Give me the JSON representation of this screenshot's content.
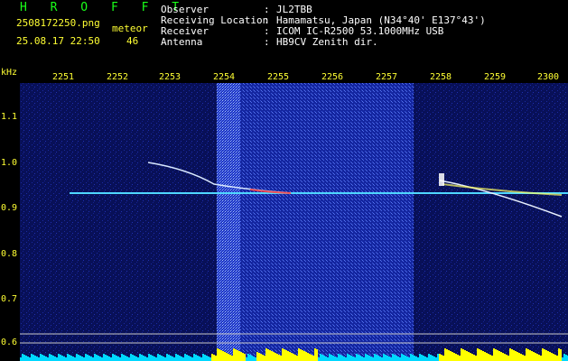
{
  "header": {
    "app_name": "H R O F F T",
    "filename": "2508172250.png",
    "mode": "meteor",
    "datetime": "25.08.17 22:50",
    "count": "46",
    "fields": [
      {
        "label": "Observer",
        "sep": ":",
        "value": "JL2TBB"
      },
      {
        "label": "Receiving Location",
        "sep": ":",
        "value": "Hamamatsu, Japan (N34°40' E137°43')"
      },
      {
        "label": "Receiver",
        "sep": ":",
        "value": "ICOM IC-R2500 53.1000MHz USB"
      },
      {
        "label": "Antenna",
        "sep": ":",
        "value": "HB9CV Zenith dir."
      }
    ]
  },
  "axis": {
    "unit": "kHz",
    "x_ticks": [
      "2251",
      "2252",
      "2253",
      "2254",
      "2255",
      "2256",
      "2257",
      "2258",
      "2259",
      "2300"
    ],
    "y_ticks": [
      "1.1",
      "1.0",
      "0.9",
      "0.8",
      "0.7",
      "0.6"
    ]
  },
  "colors": {
    "background": "#000000",
    "spectrum_bg": "#0a1060",
    "noise": "#2a3cc8",
    "carrier": "#4fd6ff",
    "signal_yellow": "#ffff00",
    "level_cyan": "#00d8ff",
    "label_yellow": "#ffff33",
    "title_green": "#19ff19"
  }
}
